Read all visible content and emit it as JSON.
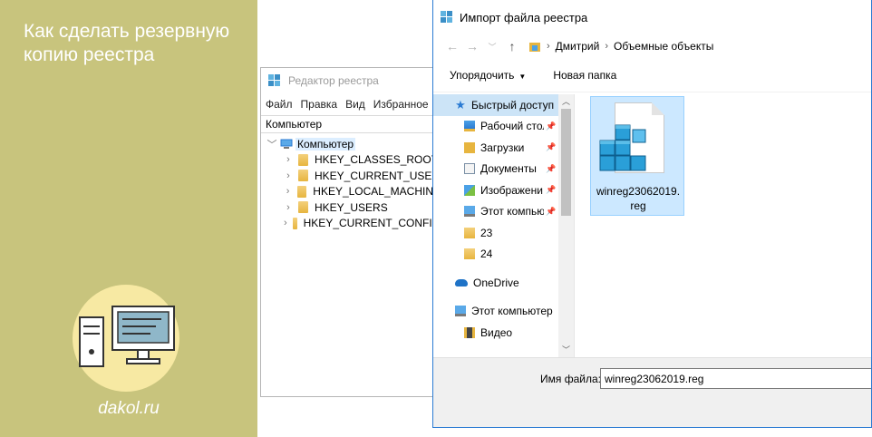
{
  "banner": {
    "title": "Как сделать резервную копию реестра",
    "site": "dakol.ru"
  },
  "regedit": {
    "title": "Редактор реестра",
    "menu": [
      "Файл",
      "Правка",
      "Вид",
      "Избранное"
    ],
    "address": "Компьютер",
    "root": "Компьютер",
    "keys": [
      "HKEY_CLASSES_ROOT",
      "HKEY_CURRENT_USER",
      "HKEY_LOCAL_MACHINE",
      "HKEY_USERS",
      "HKEY_CURRENT_CONFIG"
    ]
  },
  "dialog": {
    "title": "Импорт файла реестра",
    "breadcrumb": [
      "Дмитрий",
      "Объемные объекты"
    ],
    "toolbar": {
      "organize": "Упорядочить",
      "new_folder": "Новая папка"
    },
    "nav": {
      "quick_access": "Быстрый доступ",
      "desktop": "Рабочий стол",
      "downloads": "Загрузки",
      "documents": "Документы",
      "images": "Изображени",
      "this_pc_pinned": "Этот компью",
      "folder_23": "23",
      "folder_24": "24",
      "onedrive": "OneDrive",
      "this_pc": "Этот компьютер",
      "video": "Видео"
    },
    "file": {
      "name_line1": "winreg23062019.",
      "name_line2": "reg"
    },
    "filename_label": "Имя файла:",
    "filename_value": "winreg23062019.reg"
  },
  "colors": {
    "banner_bg": "#c8c47d",
    "accent": "#2b7bd3",
    "selection": "#cce8ff"
  }
}
